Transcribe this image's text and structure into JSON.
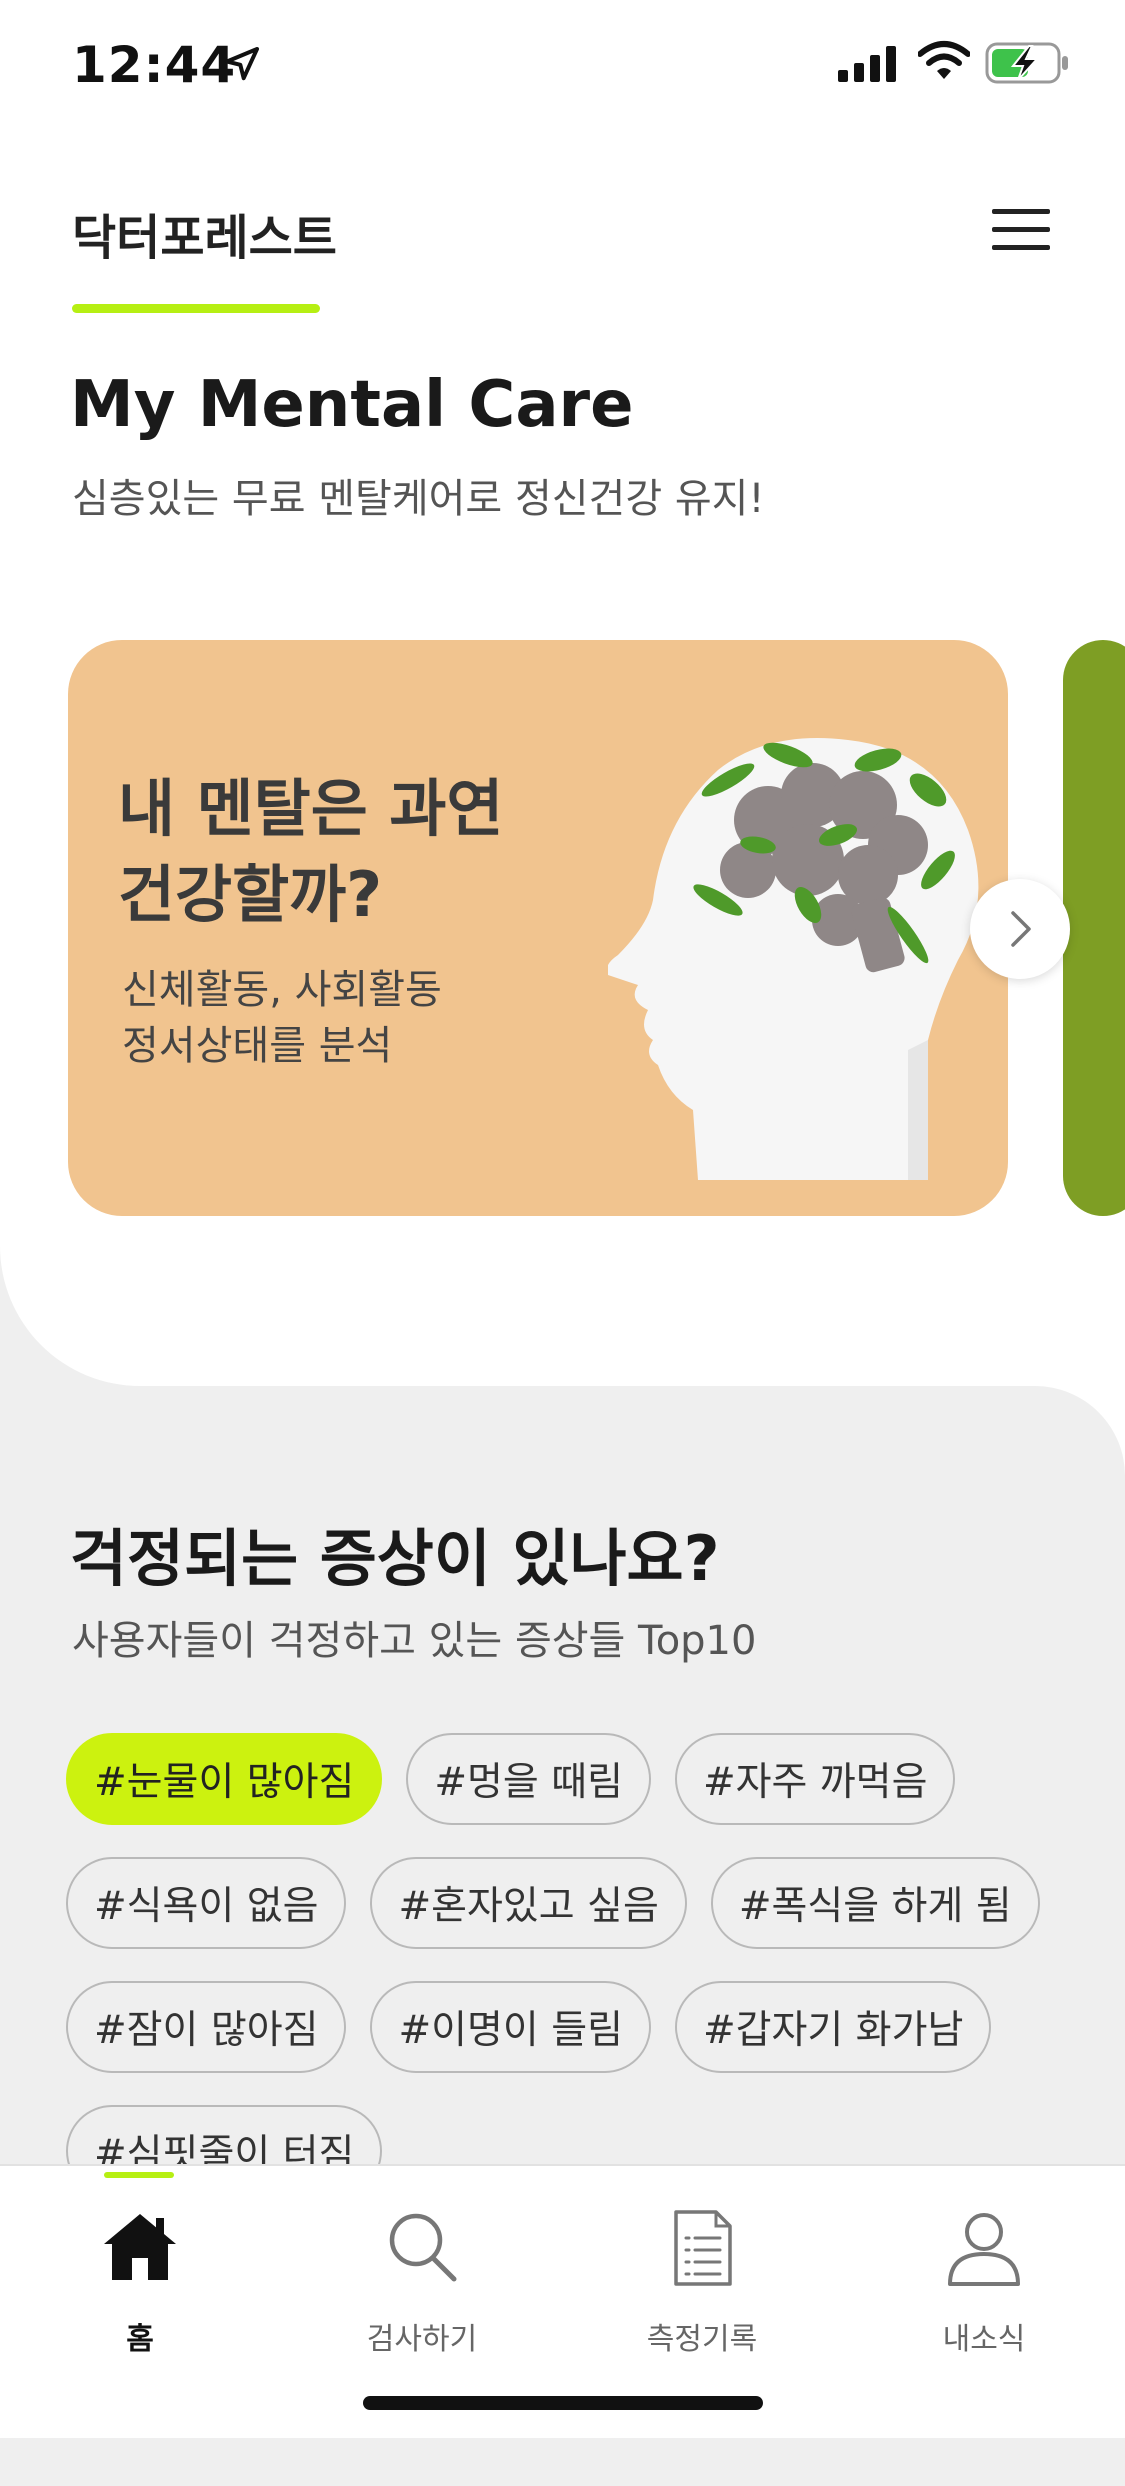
{
  "status_bar": {
    "time": "12:44"
  },
  "header": {
    "brand": "닥터포레스트"
  },
  "hero": {
    "title": "My Mental Care",
    "subtitle": "심층있는 무료 멘탈케어로 정신건강 유지!"
  },
  "carousel": {
    "card": {
      "title": "내 멘탈은 과연\n건강할까?",
      "description": "신체활동, 사회활동\n정서상태를 분석",
      "background": "#f1c48f"
    },
    "next_card_color": "#7e9e24"
  },
  "symptoms": {
    "title": "걱정되는 증상이 있나요?",
    "subtitle": "사용자들이 걱정하고 있는 증상들 Top10",
    "tags": [
      "#눈물이 많아짐",
      "#멍을 때림",
      "#자주 까먹음",
      "#식욕이 없음",
      "#혼자있고 싶음",
      "#폭식을 하게 됨",
      "#잠이 많아짐",
      "#이명이 들림",
      "#갑자기 화가남",
      "#심핏줄이 터짐"
    ],
    "active_tag_color": "#ccf20f"
  },
  "bottom_nav": {
    "items": [
      {
        "label": "홈",
        "icon": "home-icon"
      },
      {
        "label": "검사하기",
        "icon": "search-icon"
      },
      {
        "label": "측정기록",
        "icon": "document-icon"
      },
      {
        "label": "내소식",
        "icon": "person-icon"
      }
    ]
  },
  "colors": {
    "accent": "#b6ef13"
  }
}
